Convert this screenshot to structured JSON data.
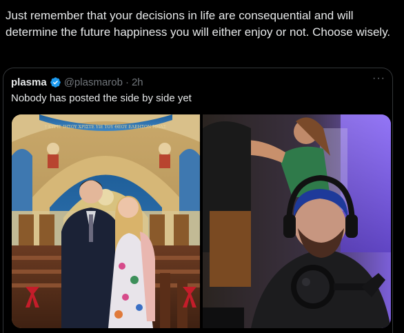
{
  "post": {
    "text": "Just remember that your decisions in life are consequential and will determine the future happiness you will either enjoy or not. Choose wisely."
  },
  "quoted_post": {
    "display_name": "plasma",
    "handle": "@plasmarob",
    "separator": "·",
    "time": "2h",
    "text": "Nobody has posted the side by side yet",
    "more_label": "···",
    "verified_color": "#1d9bf0"
  },
  "media": {
    "mosaic_text": "† ΚΥΡΙΕ ΙΗΣΟΥ ΧΡΙΣΤΕ ΥΙΕ ΤΟΥ ΘΕΟΥ ΕΛΕΗΣΟΝ ΗΜΑΣ",
    "left_photo": "couple-in-church-photo",
    "right_photo": "streamer-webcam-photo"
  }
}
